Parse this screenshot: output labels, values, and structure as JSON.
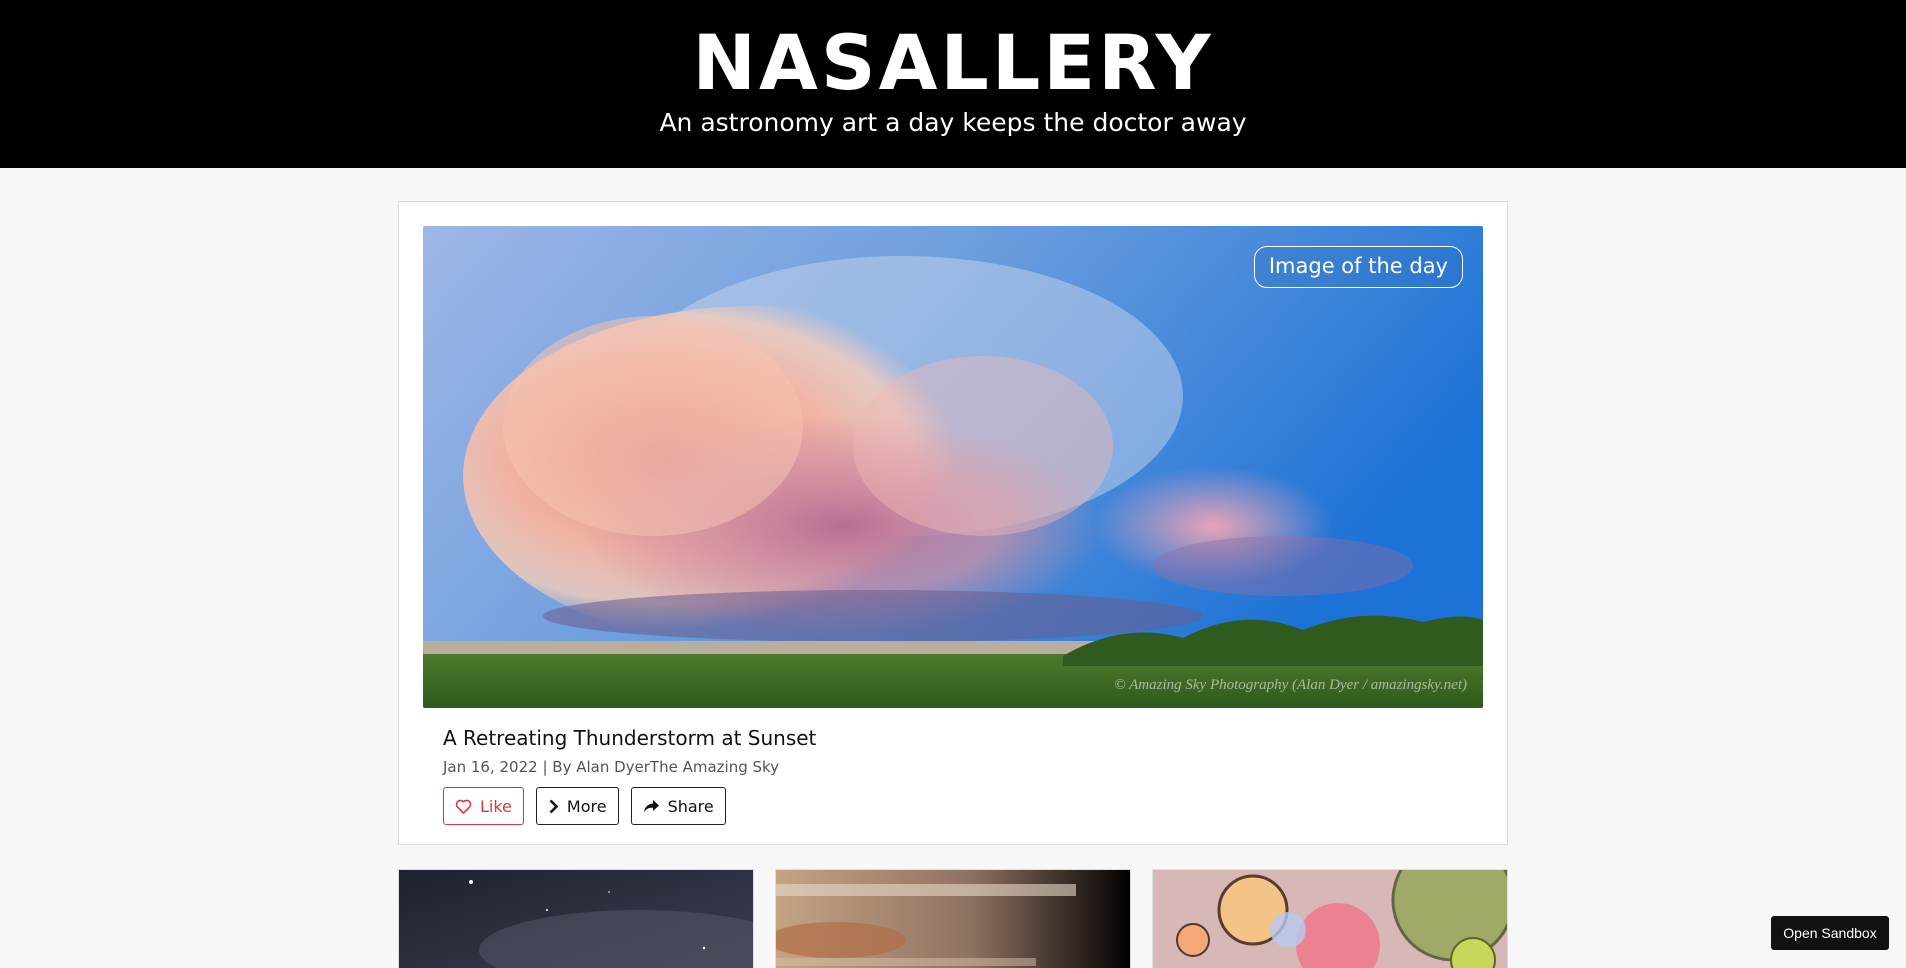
{
  "header": {
    "title": "NASALLERY",
    "tagline": "An astronomy art a day keeps the doctor away"
  },
  "featured": {
    "badge": "Image of the day",
    "image_credit": "© Amazing Sky Photography (Alan Dyer / amazingsky.net)",
    "title": "A Retreating Thunderstorm at Sunset",
    "meta": "Jan 16, 2022 | By Alan DyerThe Amazing Sky",
    "actions": {
      "like": "Like",
      "more": "More",
      "share": "Share"
    },
    "icons": {
      "like": "heart-icon",
      "more": "chevron-right-icon",
      "share": "share-icon"
    },
    "colors": {
      "like_accent": "#dc3545"
    }
  },
  "sandbox": {
    "label": "Open Sandbox"
  }
}
